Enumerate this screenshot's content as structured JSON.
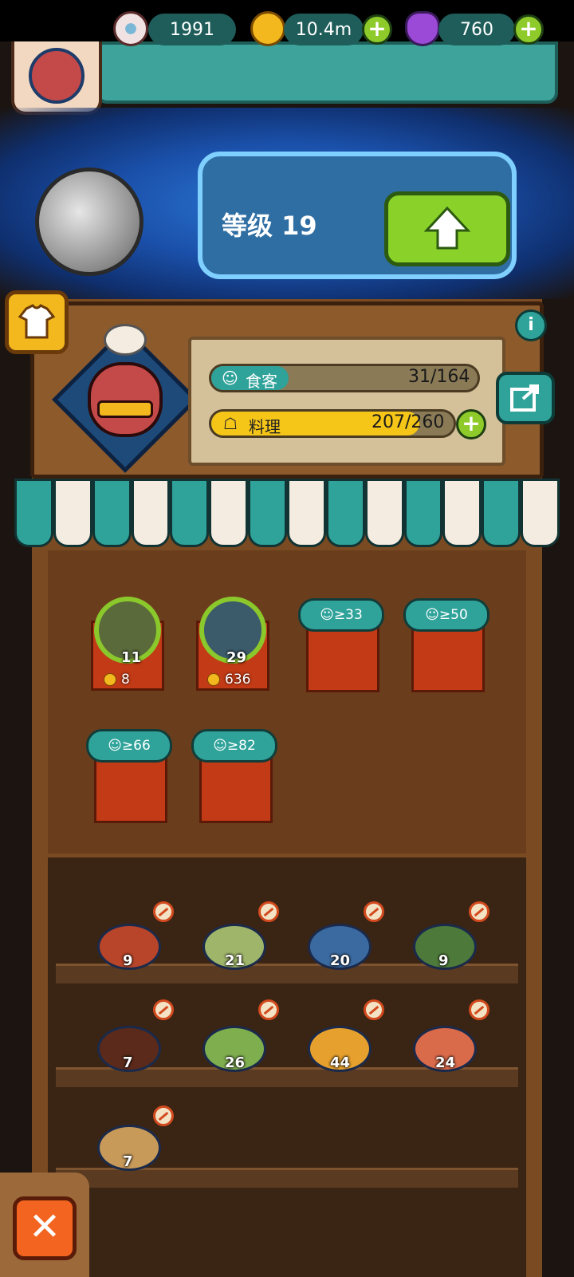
{
  "resources": {
    "eyeballs": "1991",
    "coins": "10.4m",
    "potions": "760"
  },
  "level": {
    "label": "等级 19"
  },
  "shop_stats": {
    "customers_label": "食客",
    "customers_value": "31/164",
    "customers_fill": 0.19,
    "dishes_label": "料理",
    "dishes_value": "207/260",
    "dishes_fill": 0.8
  },
  "counter_slots": [
    {
      "type": "dish",
      "name": "rice-ball",
      "count": "11",
      "price": "8"
    },
    {
      "type": "dish",
      "name": "green-platter",
      "count": "29",
      "price": "636"
    },
    {
      "type": "locked",
      "requirement": "≥33"
    },
    {
      "type": "locked",
      "requirement": "≥50"
    },
    {
      "type": "locked",
      "requirement": "≥66"
    },
    {
      "type": "locked",
      "requirement": "≥82"
    }
  ],
  "shelf_dishes": [
    {
      "count": "9",
      "color": "#b8452a"
    },
    {
      "count": "21",
      "color": "#9fb56a"
    },
    {
      "count": "20",
      "color": "#3b6aa0"
    },
    {
      "count": "9",
      "color": "#4d7a3a"
    },
    {
      "count": "7",
      "color": "#5b2a1a"
    },
    {
      "count": "26",
      "color": "#7fae4f"
    },
    {
      "count": "44",
      "color": "#e6a02e"
    },
    {
      "count": "24",
      "color": "#d96a4a"
    },
    {
      "count": "7",
      "color": "#c79a5a"
    }
  ],
  "colors": {
    "accent_green": "#8ad22a",
    "teal": "#2fa39a",
    "wood": "#7a4a22"
  }
}
